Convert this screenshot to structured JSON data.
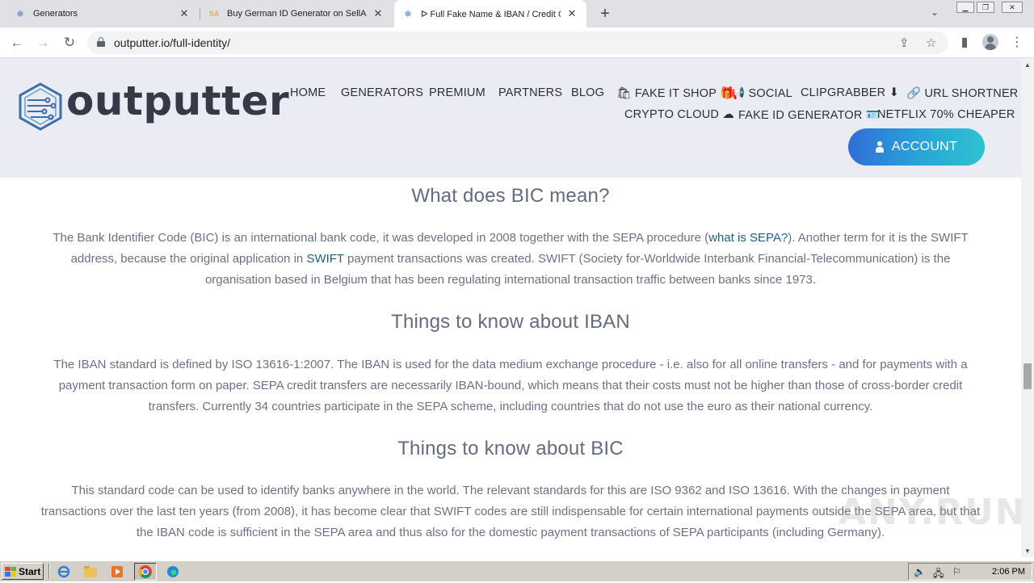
{
  "browser": {
    "tabs": [
      {
        "label": "Generators",
        "active": false
      },
      {
        "label": "Buy German ID Generator on SellApp",
        "active": false
      },
      {
        "label": "ᐅ Full Fake Name & IBAN / Credit Ca",
        "active": true
      }
    ],
    "url": "outputter.io/full-identity/"
  },
  "site": {
    "logo_text": "outputter",
    "nav": {
      "home": "HOME",
      "generators": "GENERATORS",
      "premium": "PREMIUM",
      "partners": "PARTNERS",
      "blog": "BLOG",
      "fake_it_shop": "🛍 FAKE IT SHOP 🎁",
      "social": "📢 SOCIAL",
      "clipgrabber": "CLIPGRABBER ⬇",
      "url_shortner": "🔗 URL SHORTNER",
      "crypto_cloud": "CRYPTO CLOUD ☁",
      "fake_id_generator": "FAKE ID GENERATOR 🪪",
      "netflix": "NETFLIX 70% CHEAPER"
    },
    "account_label": "ACCOUNT"
  },
  "content": {
    "bic_heading": "What does BIC mean?",
    "bic_p_1": "The Bank Identifier Code (BIC) is an international bank code, it was developed in 2008 together with the SEPA procedure (",
    "bic_p_link1": "what is SEPA?",
    "bic_p_2": "). Another term for it is the SWIFT address, because the original application in ",
    "bic_p_link2": "SWIFT",
    "bic_p_3": " payment transactions was created. SWIFT (Society for-Worldwide Interbank Financial-Telecommunication) is the organisation based in Belgium that has been regulating international transaction traffic between banks since 1973.",
    "iban_heading": "Things to know about IBAN",
    "iban_p": "The IBAN standard is defined by ISO 13616-1:2007. The IBAN is used for the data medium exchange procedure - i.e. also for all online transfers - and for payments with a payment transaction form on paper. SEPA credit transfers are necessarily IBAN-bound, which means that their costs must not be higher than those of cross-border credit transfers. Currently 34 countries participate in the SEPA scheme, including countries that do not use the euro as their national currency.",
    "bic2_heading": "Things to know about BIC",
    "bic2_p": "This standard code can be used to identify banks anywhere in the world. The relevant standards for this are ISO 9362 and ISO 13616. With the changes in payment transactions over the last ten years (from 2008), it has become clear that SWIFT codes are still indispensable for certain international payments outside the SEPA area, but that the IBAN code is sufficient in the SEPA area and thus also for the domestic payment transactions of SEPA participants (including Germany)."
  },
  "watermark": "ANY.RUN",
  "taskbar": {
    "start_label": "Start",
    "clock": "2:06 PM"
  },
  "colors": {
    "header_bg": "#ebebf4",
    "accent_gradient_start": "#2f6fd6",
    "accent_gradient_end": "#2fc2cf",
    "link": "#1f5f8b"
  }
}
